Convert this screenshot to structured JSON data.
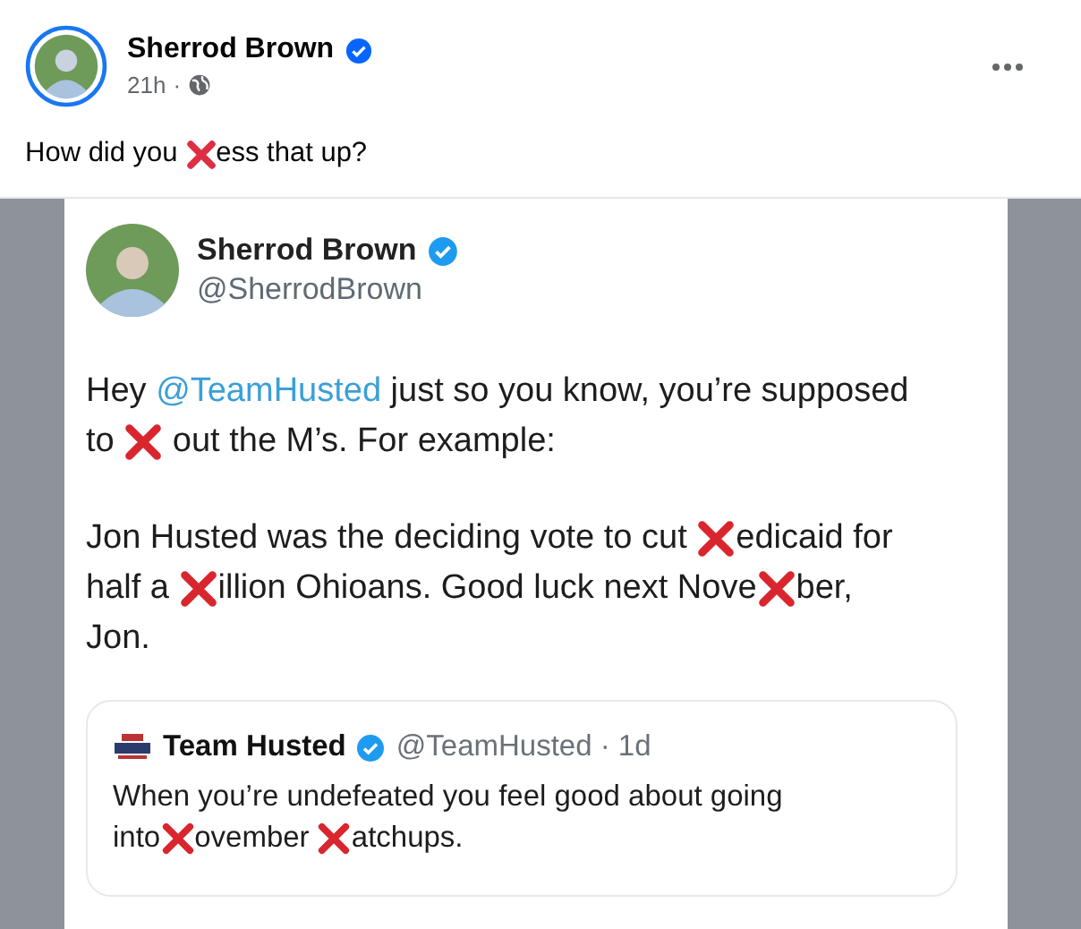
{
  "post": {
    "author": "Sherrod Brown",
    "verified": true,
    "time": "21h",
    "separator": "·",
    "text": [
      {
        "kind": "text",
        "text": "How did you "
      },
      {
        "kind": "cross"
      },
      {
        "kind": "text",
        "text": "ess that up?"
      }
    ]
  },
  "tweet": {
    "author": "Sherrod Brown",
    "verified": true,
    "handle": "@SherrodBrown",
    "paragraphs": [
      [
        [
          {
            "kind": "text",
            "text": "Hey "
          },
          {
            "kind": "mention",
            "text": "@TeamHusted"
          },
          {
            "kind": "text",
            "text": " just so you know, you’re supposed"
          }
        ],
        [
          {
            "kind": "text",
            "text": "to "
          },
          {
            "kind": "cross"
          },
          {
            "kind": "text",
            "text": " out the M’s. For example:"
          }
        ]
      ],
      [
        [
          {
            "kind": "text",
            "text": "Jon Husted was the deciding vote to cut "
          },
          {
            "kind": "cross"
          },
          {
            "kind": "text",
            "text": "edicaid for"
          }
        ],
        [
          {
            "kind": "text",
            "text": "half a "
          },
          {
            "kind": "cross"
          },
          {
            "kind": "text",
            "text": "illion Ohioans. Good luck next Nove"
          },
          {
            "kind": "cross"
          },
          {
            "kind": "text",
            "text": "ber,"
          }
        ],
        [
          {
            "kind": "text",
            "text": "Jon."
          }
        ]
      ]
    ],
    "quote": {
      "author": "Team Husted",
      "verified": true,
      "handle": "@TeamHusted · 1d",
      "lines": [
        [
          {
            "kind": "text",
            "text": "When you’re undefeated you feel good about going"
          }
        ],
        [
          {
            "kind": "text",
            "text": "into"
          },
          {
            "kind": "cross"
          },
          {
            "kind": "text",
            "text": "ovember "
          },
          {
            "kind": "cross"
          },
          {
            "kind": "text",
            "text": "atchups."
          }
        ]
      ]
    }
  }
}
